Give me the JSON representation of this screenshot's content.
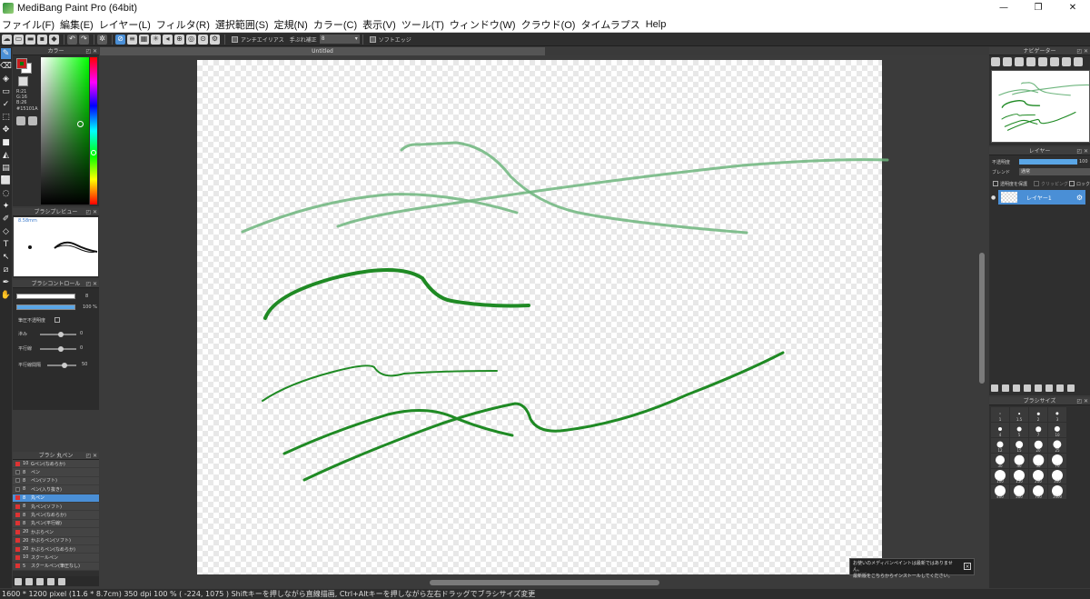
{
  "window": {
    "title": "MediBang Paint Pro (64bit)",
    "minimize": "—",
    "maximize": "❐",
    "close": "✕"
  },
  "menu": [
    "ファイル(F)",
    "編集(E)",
    "レイヤー(L)",
    "フィルタ(R)",
    "選択範囲(S)",
    "定規(N)",
    "カラー(C)",
    "表示(V)",
    "ツール(T)",
    "ウィンドウ(W)",
    "クラウド(O)",
    "タイムラプス",
    "Help"
  ],
  "toolbar": {
    "antialias_label": "アンチエイリアス",
    "correction_label": "手ぶれ補正",
    "correction_value": "8",
    "soft_edge_label": "ソフトエッジ"
  },
  "color_panel": {
    "title": "カラー",
    "r": "R:21",
    "g": "G:16",
    "b": "B:26",
    "hex": "#15101A",
    "fg_color": "#1a8a1a"
  },
  "brush_preview": {
    "title": "ブラシプレビュー",
    "size_label": "8.58mm"
  },
  "brush_control": {
    "title": "ブラシコントロール",
    "size_value": "8",
    "opacity_value": "100 %",
    "pressure_label": "筆圧不透明度",
    "smoothing_label": "滲み",
    "smoothing_value": "0",
    "parallel_label": "平行線",
    "parallel_value": "0",
    "parallel_spacing_label": "平行線間隔",
    "parallel_spacing_value": "50"
  },
  "brush_list": {
    "title": "ブラシ 丸ペン",
    "selected_index": 4,
    "items": [
      {
        "num": "10",
        "name": "Gペン(なめらか)",
        "color": "#d33"
      },
      {
        "num": "8",
        "name": "ペン",
        "color": "#3a3a3a"
      },
      {
        "num": "8",
        "name": "ペン(ソフト)",
        "color": "#3a3a3a"
      },
      {
        "num": "8",
        "name": "ペン(入り抜き)",
        "color": "#3a3a3a"
      },
      {
        "num": "8",
        "name": "丸ペン",
        "color": "#d33"
      },
      {
        "num": "8",
        "name": "丸ペン(ソフト)",
        "color": "#d33"
      },
      {
        "num": "8",
        "name": "丸ペン(なめらか)",
        "color": "#d33"
      },
      {
        "num": "8",
        "name": "丸ペン(平行線)",
        "color": "#d33"
      },
      {
        "num": "20",
        "name": "かぶらペン",
        "color": "#d33"
      },
      {
        "num": "20",
        "name": "かぶらペン(ソフト)",
        "color": "#d33"
      },
      {
        "num": "20",
        "name": "かぶらペン(なめらか)",
        "color": "#d33"
      },
      {
        "num": "10",
        "name": "スクールペン",
        "color": "#d33"
      },
      {
        "num": "5",
        "name": "スクールペン(筆圧なし)",
        "color": "#d33"
      }
    ]
  },
  "document": {
    "tab_title": "Untitled"
  },
  "notice": {
    "line1": "お使いのメディバンペイントは最新ではありません。",
    "line2": "最新版をこちらからインストールしてください。"
  },
  "navigator": {
    "title": "ナビゲーター"
  },
  "layer_panel": {
    "title": "レイヤー",
    "opacity_label": "不透明度",
    "opacity_value": "100",
    "blend_label": "ブレンド",
    "blend_value": "通常",
    "protect_alpha_label": "透明度を保護",
    "clipping_label": "クリッピング",
    "lock_label": "ロック",
    "layer_name": "レイヤー1"
  },
  "brush_size": {
    "title": "ブラシサイズ",
    "sizes": [
      "1",
      "1.5",
      "2",
      "3",
      "4",
      "5",
      "7",
      "10",
      "12",
      "15",
      "20",
      "25",
      "30",
      "40",
      "50",
      "70",
      "100",
      "150",
      "200",
      "300",
      "400",
      "500",
      "700",
      "1000"
    ]
  },
  "status": {
    "text": "1600 * 1200 pixel  (11.6 * 8.7cm)  350 dpi  100 %  ( -224, 1075 )  Shiftキーを押しながら直線描画, Ctrl+Altキーを押しながら左右ドラッグでブラシサイズ変更"
  },
  "colors": {
    "stroke_light": "#6db57d",
    "stroke_dark": "#1f8a24",
    "accent": "#4a8fd6"
  }
}
